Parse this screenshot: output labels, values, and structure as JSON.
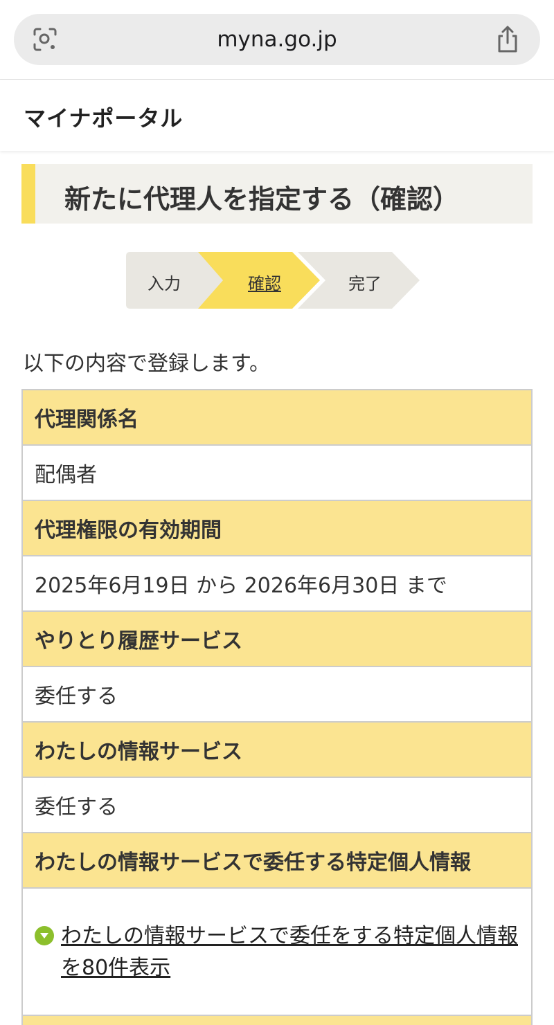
{
  "browser": {
    "url": "myna.go.jp",
    "left_icon": "visual-search-icon",
    "right_icon": "share-icon"
  },
  "site": {
    "title": "マイナポータル"
  },
  "page": {
    "heading": "新たに代理人を指定する（確認）",
    "accent_color": "#f9dd5b"
  },
  "steps": [
    {
      "label": "入力",
      "state": "done"
    },
    {
      "label": "確認",
      "state": "current"
    },
    {
      "label": "完了",
      "state": "pending"
    }
  ],
  "intro": "以下の内容で登録します。",
  "table": {
    "rows": [
      {
        "heading": "代理関係名",
        "value": "配偶者"
      },
      {
        "heading": "代理権限の有効期間",
        "value": "2025年6月19日 から 2026年6月30日 まで"
      },
      {
        "heading": "やりとり履歴サービス",
        "value": "委任する"
      },
      {
        "heading": "わたしの情報サービス",
        "value": "委任する"
      },
      {
        "heading": "わたしの情報サービスで委任する特定個人情報"
      }
    ],
    "expand_link": "わたしの情報サービスで委任をする特定個人情報を80件表示"
  },
  "colors": {
    "table_header_bg": "#fbe491",
    "step_current_bg": "#f9dd5b",
    "step_other_bg": "#e9e7e1",
    "bullet": "#8cbf2c"
  }
}
